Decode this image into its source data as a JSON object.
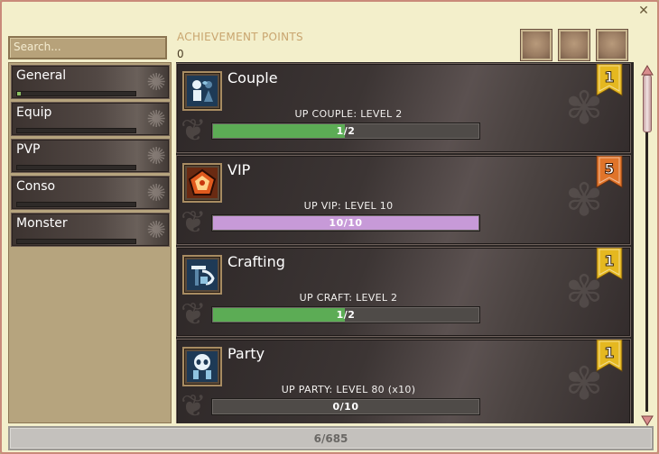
{
  "window": {
    "close_glyph": "✕"
  },
  "search": {
    "placeholder": "Search..."
  },
  "achievement_points": {
    "label": "ACHIEVEMENT POINTS",
    "value": "0"
  },
  "categories": [
    {
      "label": "General",
      "progress": 0.03
    },
    {
      "label": "Equip",
      "progress": 0
    },
    {
      "label": "PVP",
      "progress": 0
    },
    {
      "label": "Conso",
      "progress": 0
    },
    {
      "label": "Monster",
      "progress": 0
    }
  ],
  "achievements": [
    {
      "title": "Couple",
      "description": "UP COUPLE: LEVEL 2",
      "progress_text": "1/2",
      "progress": 0.5,
      "bar_color": "#5cac55",
      "rank": "1",
      "rank_color": "#e5b820",
      "icon": "couple-icon"
    },
    {
      "title": "VIP",
      "description": "UP VIP: LEVEL 10",
      "progress_text": "10/10",
      "progress": 1.0,
      "bar_color": "#c79ad8",
      "rank": "5",
      "rank_color": "#e0742a",
      "icon": "vip-icon"
    },
    {
      "title": "Crafting",
      "description": "UP CRAFT: LEVEL 2",
      "progress_text": "1/2",
      "progress": 0.5,
      "bar_color": "#5cac55",
      "rank": "1",
      "rank_color": "#e5b820",
      "icon": "crafting-icon"
    },
    {
      "title": "Party",
      "description": "UP PARTY: LEVEL 80 (x10)",
      "progress_text": "0/10",
      "progress": 0,
      "bar_color": "#5cac55",
      "rank": "1",
      "rank_color": "#e5b820",
      "icon": "party-icon"
    }
  ],
  "footer": {
    "total_progress": "6/685"
  }
}
